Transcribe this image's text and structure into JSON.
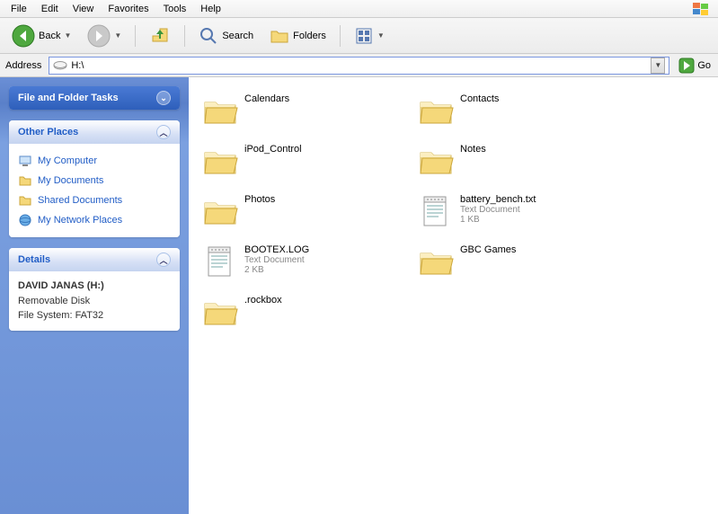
{
  "menu": {
    "file": "File",
    "edit": "Edit",
    "view": "View",
    "favorites": "Favorites",
    "tools": "Tools",
    "help": "Help"
  },
  "toolbar": {
    "back": "Back",
    "search": "Search",
    "folders": "Folders"
  },
  "address": {
    "label": "Address",
    "value": "H:\\",
    "go": "Go"
  },
  "panels": {
    "tasks": {
      "title": "File and Folder Tasks"
    },
    "places": {
      "title": "Other Places",
      "items": [
        "My Computer",
        "My Documents",
        "Shared Documents",
        "My Network Places"
      ]
    },
    "details": {
      "title": "Details",
      "name": "DAVID JANAS (H:)",
      "type": "Removable Disk",
      "fs": "File System: FAT32"
    }
  },
  "files": [
    {
      "name": "Calendars",
      "kind": "folder"
    },
    {
      "name": "Contacts",
      "kind": "folder"
    },
    {
      "name": "iPod_Control",
      "kind": "folder"
    },
    {
      "name": "Notes",
      "kind": "folder"
    },
    {
      "name": "Photos",
      "kind": "folder"
    },
    {
      "name": "battery_bench.txt",
      "kind": "txt",
      "sub1": "Text Document",
      "sub2": "1 KB"
    },
    {
      "name": "BOOTEX.LOG",
      "kind": "txt",
      "sub1": "Text Document",
      "sub2": "2 KB"
    },
    {
      "name": "GBC Games",
      "kind": "folder"
    },
    {
      "name": ".rockbox",
      "kind": "folder"
    }
  ]
}
